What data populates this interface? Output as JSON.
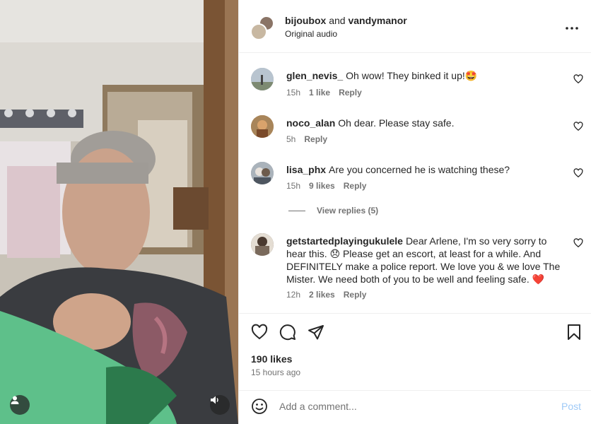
{
  "post": {
    "authors": "bijoubox",
    "and_word": "and",
    "coauthor": "vandymanor",
    "audio": "Original audio"
  },
  "comments": [
    {
      "user": "glen_nevis_",
      "text": "Oh wow! They binked it up!🤩",
      "time": "15h",
      "likes": "1 like",
      "reply": "Reply"
    },
    {
      "user": "noco_alan",
      "text": "Oh dear. Please stay safe.",
      "time": "5h",
      "likes": "",
      "reply": "Reply"
    },
    {
      "user": "lisa_phx",
      "text": "Are you concerned he is watching these?",
      "time": "15h",
      "likes": "9 likes",
      "reply": "Reply"
    },
    {
      "user": "getstartedplayingukulele",
      "text": "Dear Arlene, I'm so very sorry to hear this. 😞 Please get an escort, at least for a while. And DEFINITELY make a police report. We love you & we love The Mister. We need both of you to be well and feeling safe. ❤️",
      "time": "12h",
      "likes": "2 likes",
      "reply": "Reply"
    }
  ],
  "view_replies": "View replies (5)",
  "likes_count": "190 likes",
  "posted": "15 hours ago",
  "add_comment": {
    "placeholder": "Add a comment...",
    "post_label": "Post"
  },
  "colors": {
    "accent": "#0095f6",
    "post_disabled": "#9fcaf7",
    "heart": "#ed1c24"
  },
  "icons": [
    "user-icon",
    "sound-icon",
    "more-icon",
    "heart-icon",
    "comment-icon",
    "share-icon",
    "bookmark-icon",
    "emoji-icon"
  ]
}
